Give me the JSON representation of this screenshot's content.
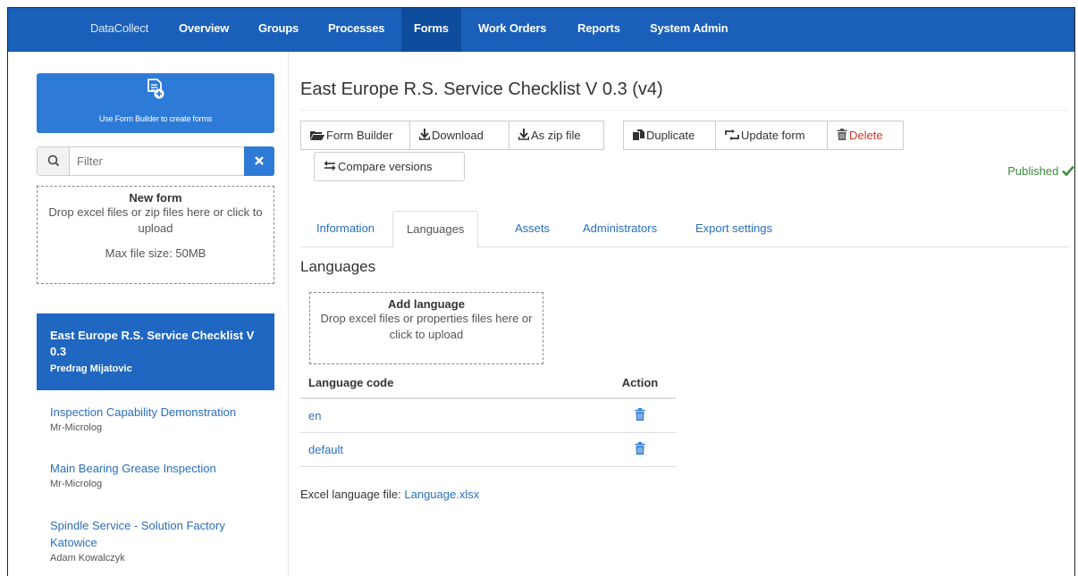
{
  "nav": {
    "brand": "DataCollect",
    "items": [
      "Overview",
      "Groups",
      "Processes",
      "Forms",
      "Work Orders",
      "Reports",
      "System Admin"
    ],
    "active": "Forms"
  },
  "sidebar": {
    "form_builder_label": "Use Form Builder to create forms",
    "filter_placeholder": "Filter",
    "new_form": {
      "title": "New form",
      "text": "Drop excel files or zip files here or click to upload",
      "max_size": "Max file size: 50MB"
    },
    "forms": [
      {
        "title": "East Europe R.S. Service Checklist V 0.3",
        "author": "Predrag Mijatovic",
        "active": true
      },
      {
        "title": "Inspection Capability Demonstration",
        "author": "Mr-Microlog",
        "active": false
      },
      {
        "title": "Main Bearing Grease Inspection",
        "author": "Mr-Microlog",
        "active": false
      },
      {
        "title": "Spindle Service - Solution Factory Katowice",
        "author": "Adam Kowalczyk",
        "active": false
      }
    ]
  },
  "main": {
    "title": "East Europe R.S. Service Checklist V 0.3 (v4)",
    "buttons": {
      "form_builder": "Form Builder",
      "download": "Download",
      "zip": "As zip file",
      "duplicate": "Duplicate",
      "update": "Update form",
      "delete": "Delete",
      "compare": "Compare versions"
    },
    "status": "Published",
    "tabs": [
      "Information",
      "Languages",
      "Assets",
      "Administrators",
      "Export settings"
    ],
    "active_tab": "Languages",
    "section_title": "Languages",
    "add_language": {
      "title": "Add language",
      "text": "Drop excel files or properties files here or click to upload"
    },
    "table": {
      "headers": [
        "Language code",
        "Action"
      ],
      "rows": [
        {
          "code": "en"
        },
        {
          "code": "default"
        }
      ]
    },
    "excel_label": "Excel language file:",
    "excel_file": "Language.xlsx"
  },
  "colors": {
    "nav_bg": "#1a5fba",
    "primary": "#2d7bd6",
    "link": "#2a6ebd",
    "success": "#3a8e3a",
    "danger": "#c43a32"
  }
}
